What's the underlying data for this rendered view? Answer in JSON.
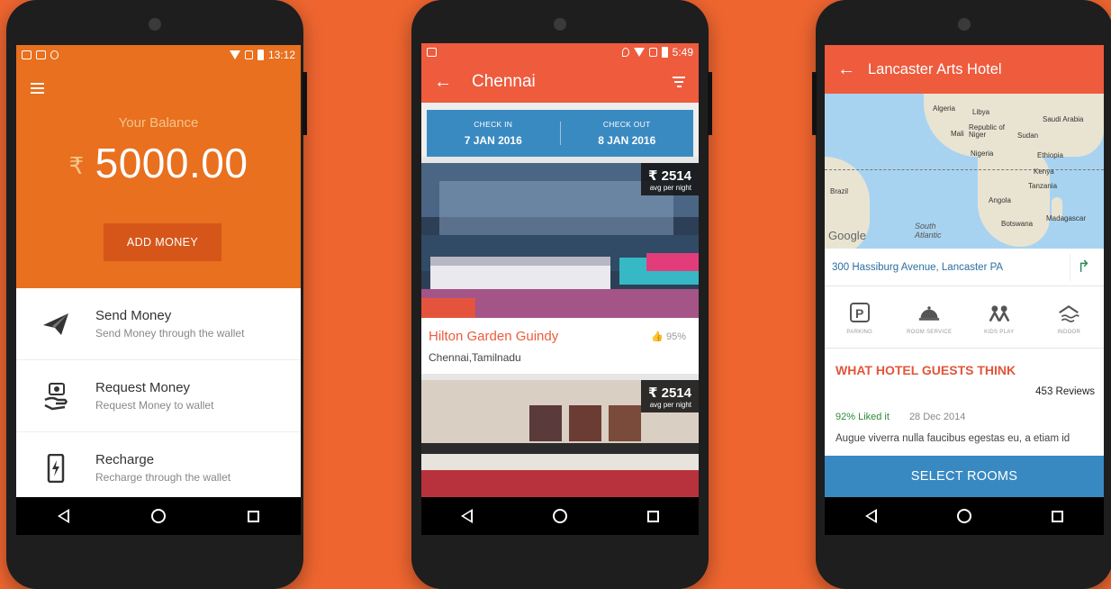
{
  "colors": {
    "background": "#ee6530",
    "wallet_header": "#e8701f",
    "add_money_button": "#d6561a",
    "app_bar": "#ee5b3d",
    "check_box": "#3a8ac2",
    "select_rooms": "#3889c2"
  },
  "wallet": {
    "status_time": "13:12",
    "balance_label": "Your Balance",
    "currency_symbol": "₹",
    "balance": "5000.00",
    "add_money": "ADD MONEY",
    "items": [
      {
        "title": "Send Money",
        "subtitle": "Send Money through the wallet",
        "icon": "paper-plane-icon"
      },
      {
        "title": "Request Money",
        "subtitle": "Request Money to wallet",
        "icon": "money-hand-icon"
      },
      {
        "title": "Recharge",
        "subtitle": "Recharge through the wallet",
        "icon": "phone-recharge-icon"
      }
    ]
  },
  "hotels": {
    "status_time": "5:49",
    "title": "Chennai",
    "check_in_label": "CHECK IN",
    "check_in_date": "7 JAN 2016",
    "check_out_label": "CHECK OUT",
    "check_out_date": "8 JAN 2016",
    "list": [
      {
        "name": "Hilton Garden Guindy",
        "location": "Chennai,Tamilnadu",
        "likes": "95%",
        "price": "₹ 2514",
        "price_sub": "avg per night"
      },
      {
        "price": "₹ 2514",
        "price_sub": "avg per night"
      }
    ]
  },
  "hotel_detail": {
    "title": "Lancaster Arts Hotel",
    "map_labels": [
      "Algeria",
      "Libya",
      "Saudi Arabia",
      "Mali",
      "Republic of Niger",
      "Sudan",
      "Nigeria",
      "Ethiopia",
      "Kenya",
      "Tanzania",
      "Brazil",
      "Angola",
      "Botswana",
      "Madagascar",
      "South Atlantic"
    ],
    "map_brand": "Google",
    "address": "300 Hassiburg Avenue, Lancaster PA",
    "amenities": [
      "PARKING",
      "ROOM SERVICE",
      "KIDS PLAY",
      "INDOOR"
    ],
    "section_title": "WHAT HOTEL GUESTS THINK",
    "review_count": "453 Reviews",
    "liked": "92% Liked it",
    "review_date": "28 Dec 2014",
    "review_text": "Augue viverra nulla faucibus egestas eu, a etiam id",
    "select_rooms": "SELECT ROOMS"
  }
}
